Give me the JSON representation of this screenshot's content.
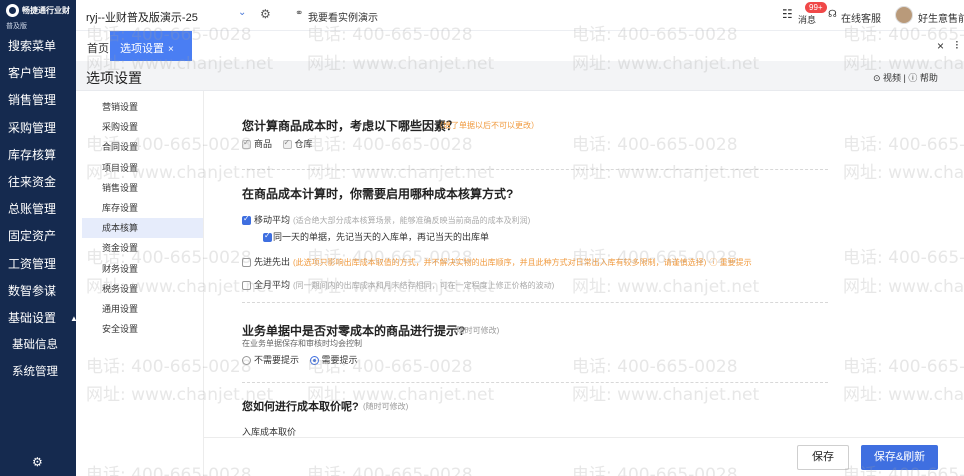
{
  "sidebar": {
    "brand": "畅捷通行业财",
    "edition": "普及版",
    "items": [
      {
        "label": "搜索菜单"
      },
      {
        "label": "客户管理"
      },
      {
        "label": "销售管理"
      },
      {
        "label": "采购管理"
      },
      {
        "label": "库存核算"
      },
      {
        "label": "往来资金"
      },
      {
        "label": "总账管理"
      },
      {
        "label": "固定资产"
      },
      {
        "label": "工资管理"
      },
      {
        "label": "数智参谋"
      },
      {
        "label": "基础设置"
      }
    ],
    "sub_items": [
      {
        "label": "基础信息"
      },
      {
        "label": "系统管理"
      }
    ],
    "settings_icon": "gear-icon"
  },
  "topbar": {
    "account": "ryj--业财普及版演示-25",
    "demo_label": "我要看实例演示",
    "message_label": "消息",
    "message_badge": "99+",
    "service_label": "在线客服",
    "user_name": "好生意售前"
  },
  "tabs": {
    "home": "首页",
    "active": "选项设置",
    "active_close": "×"
  },
  "page": {
    "title": "选项设置",
    "links": "⊙ 视频 | ⓘ 帮助"
  },
  "options_nav": {
    "items": [
      {
        "label": "营销设置"
      },
      {
        "label": "采购设置"
      },
      {
        "label": "合同设置"
      },
      {
        "label": "项目设置"
      },
      {
        "label": "销售设置"
      },
      {
        "label": "库存设置"
      },
      {
        "label": "成本核算"
      },
      {
        "label": "资金设置"
      },
      {
        "label": "财务设置"
      },
      {
        "label": "税务设置"
      },
      {
        "label": "通用设置"
      },
      {
        "label": "安全设置"
      }
    ],
    "active_index": 6
  },
  "content": {
    "q1": {
      "title": "您计算商品成本时，考虑以下哪些因素？",
      "note": "（填了单据以后不可以更改）",
      "options": [
        {
          "label": "商品",
          "checked": true
        },
        {
          "label": "仓库",
          "checked": true
        }
      ]
    },
    "q2": {
      "title": "在商品成本计算时，你需要启用哪种成本核算方式?",
      "moving_avg": {
        "label": "移动平均",
        "hint": "(适合绝大部分成本核算场景，能够准确反映当前商品的成本及利润)",
        "checked": true
      },
      "moving_avg_sub": {
        "label": "同一天的单据，先记当天的入库单，再记当天的出库单",
        "checked": true
      },
      "fifo": {
        "label": "先进先出",
        "hint": "(此选项只影响出库成本取值的方式，并不解决实物的出库顺序，并且此种方式对日常出入库有较多限制，请谨慎选择)",
        "tip": "ⓘ 重要提示",
        "checked": false
      },
      "monthly_avg": {
        "label": "全月平均",
        "hint": "(同一期间内的出库成本和月末结存相同，可在一定程度上修正价格的波动)",
        "checked": false
      }
    },
    "q3": {
      "title": "业务单据中是否对零成本的商品进行提示?",
      "note": "(随时可修改)",
      "sub": "在业务单据保存和审核时均会控制",
      "options": [
        {
          "label": "不需要提示",
          "selected": false
        },
        {
          "label": "需要提示",
          "selected": true
        }
      ]
    },
    "q4": {
      "title": "您如何进行成本取价呢?",
      "note": "(随时可修改)",
      "sub": "入库成本取价"
    }
  },
  "footer": {
    "save": "保存",
    "save_refresh": "保存&刷新"
  },
  "watermark": {
    "phone": "电话: 400-665-0028",
    "site": "网址: www.chanjet.net"
  }
}
